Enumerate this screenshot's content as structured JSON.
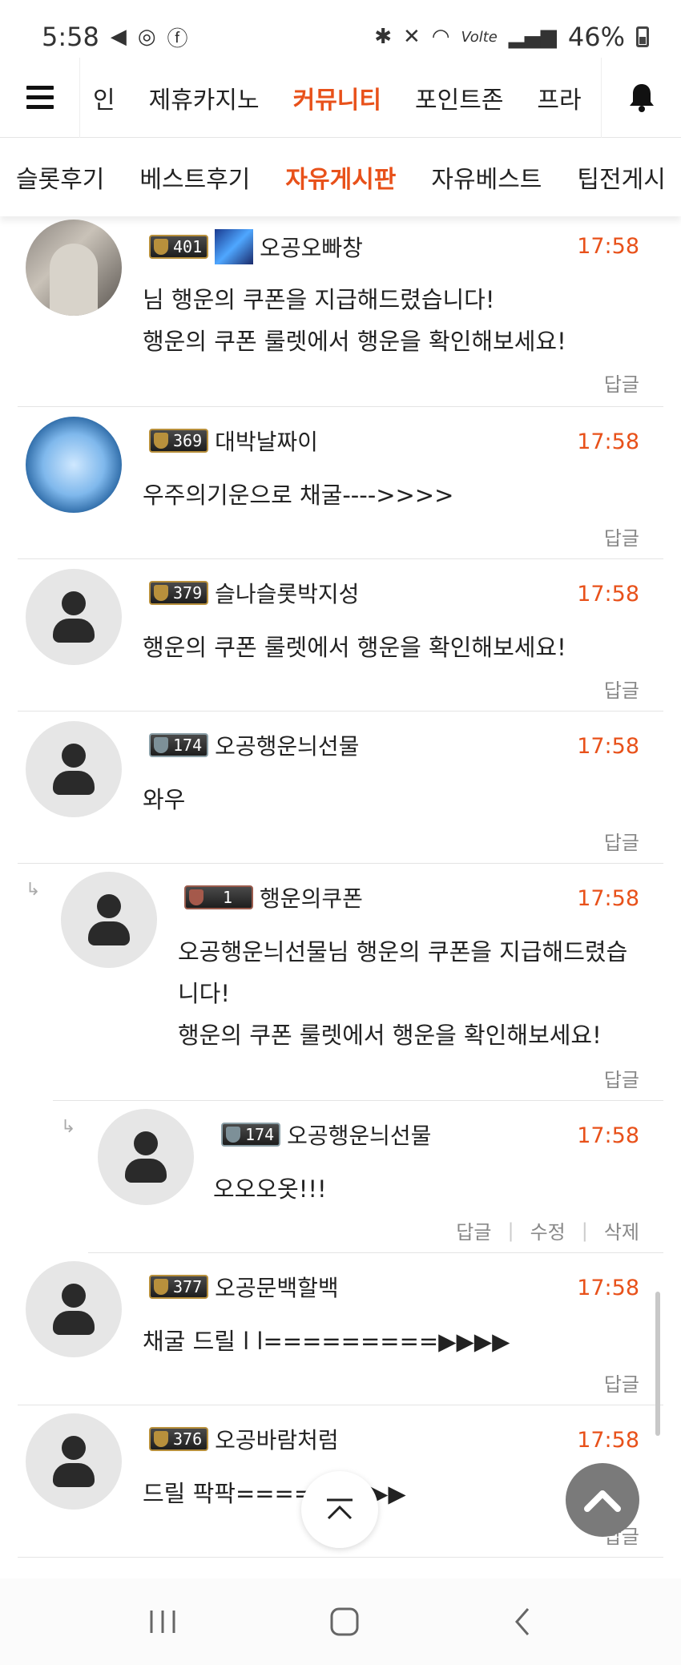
{
  "status": {
    "time": "5:58",
    "battery": "46%",
    "network": "Volte"
  },
  "main_nav": {
    "items": [
      "인",
      "제휴카지노",
      "커뮤니티",
      "포인트존",
      "프라"
    ],
    "active_index": 2
  },
  "sub_nav": {
    "items": [
      "슬롯후기",
      "베스트후기",
      "자유게시판",
      "자유베스트",
      "팁전게시"
    ],
    "active_index": 2
  },
  "comments": [
    {
      "level": "401",
      "username": "오공오빠창",
      "time": "17:58",
      "lines": [
        "님 행운의 쿠폰을 지급해드렸습니다!",
        "행운의 쿠폰 룰렛에서 행운을 확인해보세요!"
      ],
      "reply_label": "답글"
    },
    {
      "level": "369",
      "username": "대박날짜이",
      "time": "17:58",
      "lines": [
        "우주의기운으로 채굴---->>>>"
      ],
      "reply_label": "답글"
    },
    {
      "level": "379",
      "username": "슬나슬롯박지성",
      "time": "17:58",
      "lines": [
        "행운의 쿠폰 룰렛에서 행운을 확인해보세요!"
      ],
      "reply_label": "답글"
    },
    {
      "level": "174",
      "username": "오공행운늬선물",
      "time": "17:58",
      "lines": [
        "와우"
      ],
      "reply_label": "답글"
    },
    {
      "level": "1",
      "username": "행운의쿠폰",
      "time": "17:58",
      "lines": [
        "오공행운늬선물님 행운의 쿠폰을 지급해드렸습",
        "니다!",
        "행운의 쿠폰 룰렛에서 행운을 확인해보세요!"
      ],
      "reply_label": "답글"
    },
    {
      "level": "174",
      "username": "오공행운늬선물",
      "time": "17:58",
      "lines": [
        "오오오옷!!!"
      ],
      "reply_label": "답글",
      "edit_label": "수정",
      "delete_label": "삭제"
    },
    {
      "level": "377",
      "username": "오공문백할백",
      "time": "17:58",
      "lines": [
        "채굴 드릴 l l=========▶▶▶▶"
      ],
      "reply_label": "답글"
    },
    {
      "level": "376",
      "username": "오공바람처럼",
      "time": "17:58",
      "lines": [
        "드릴 팍팍======▶▶▶"
      ],
      "reply_label": "답글"
    }
  ],
  "reply_arrow": "↳"
}
